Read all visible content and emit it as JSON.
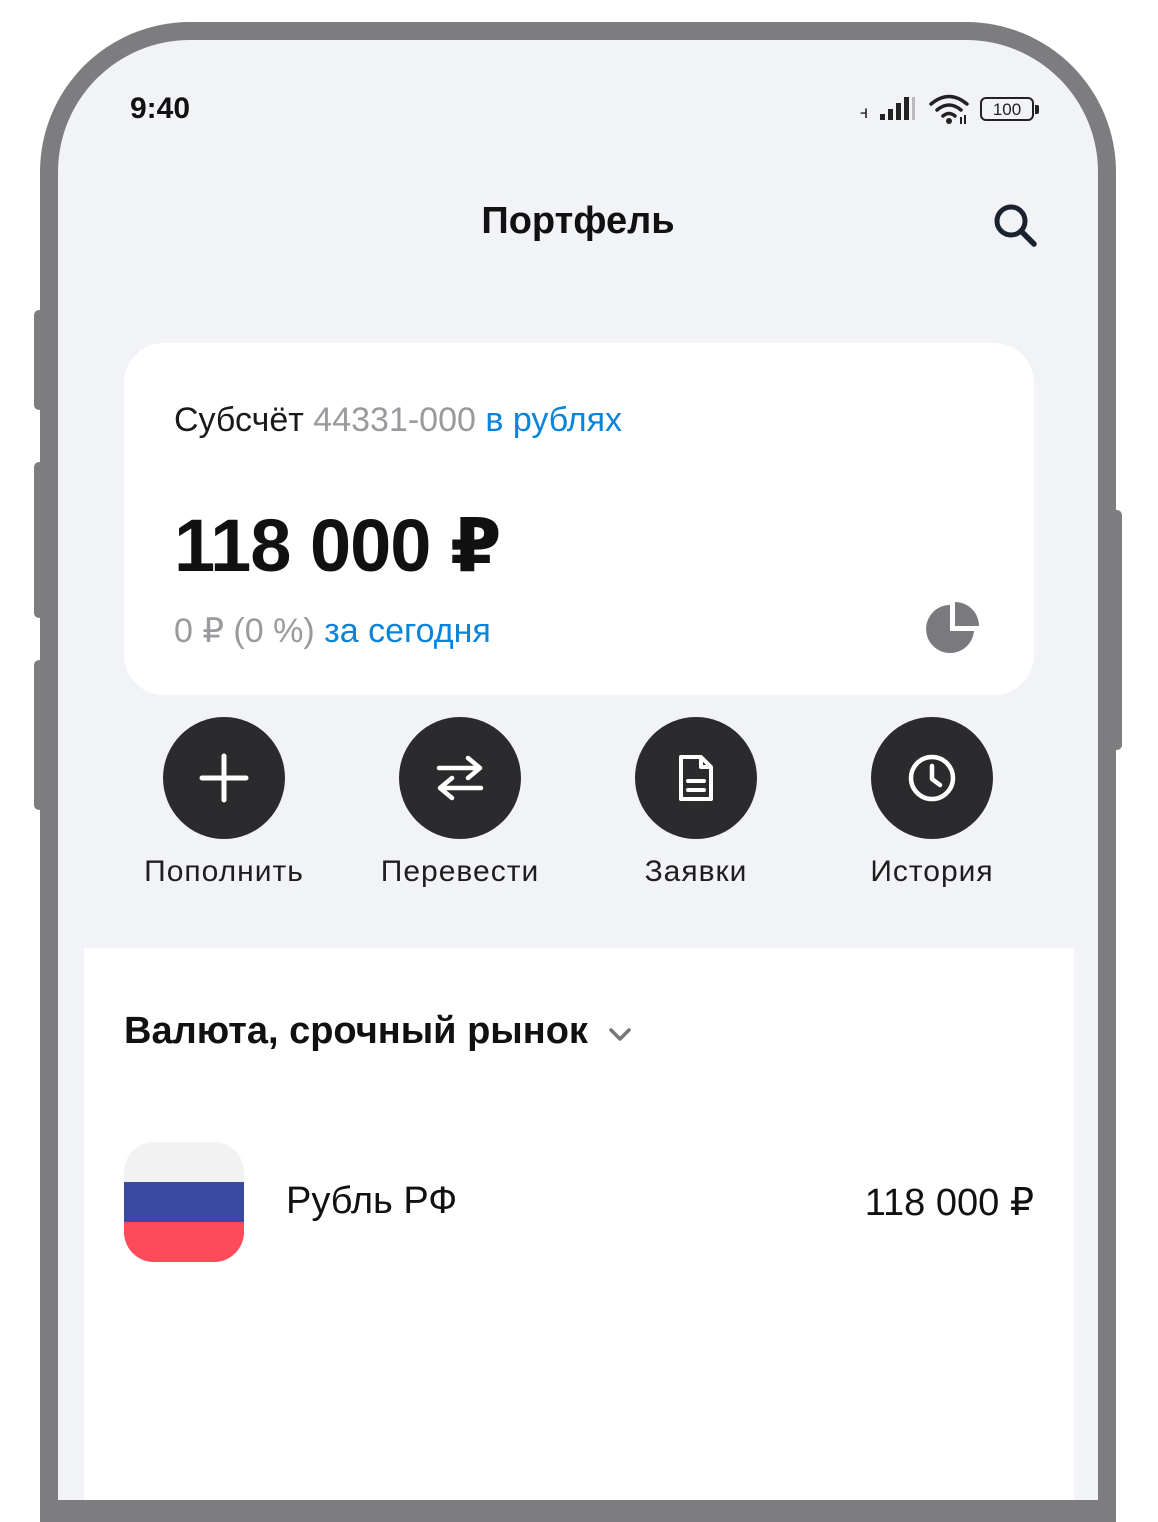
{
  "status_bar": {
    "time": "9:40",
    "battery": "100"
  },
  "header": {
    "title": "Портфель"
  },
  "account": {
    "label": "Субсчёт",
    "number": "44331-000",
    "currency_link": "в рублях",
    "balance": "118 000 ₽",
    "change": "0 ₽ (0 %)",
    "change_period": "за сегодня"
  },
  "actions": [
    {
      "label": "Пополнить",
      "icon": "plus-icon"
    },
    {
      "label": "Перевести",
      "icon": "transfer-arrows-icon"
    },
    {
      "label": "Заявки",
      "icon": "document-icon"
    },
    {
      "label": "История",
      "icon": "clock-icon"
    }
  ],
  "section": {
    "title": "Валюта, срочный рынок",
    "items": [
      {
        "name": "Рубль РФ",
        "value": "118 000 ₽",
        "icon": "russia-flag-icon"
      }
    ]
  },
  "colors": {
    "accent": "#0a84d8",
    "action_button": "#2b2b2d",
    "screen_bg": "#f1f3f6",
    "flag_white": "#f2f2f2",
    "flag_blue": "#3a4aa0",
    "flag_red": "#ff4a5a"
  }
}
